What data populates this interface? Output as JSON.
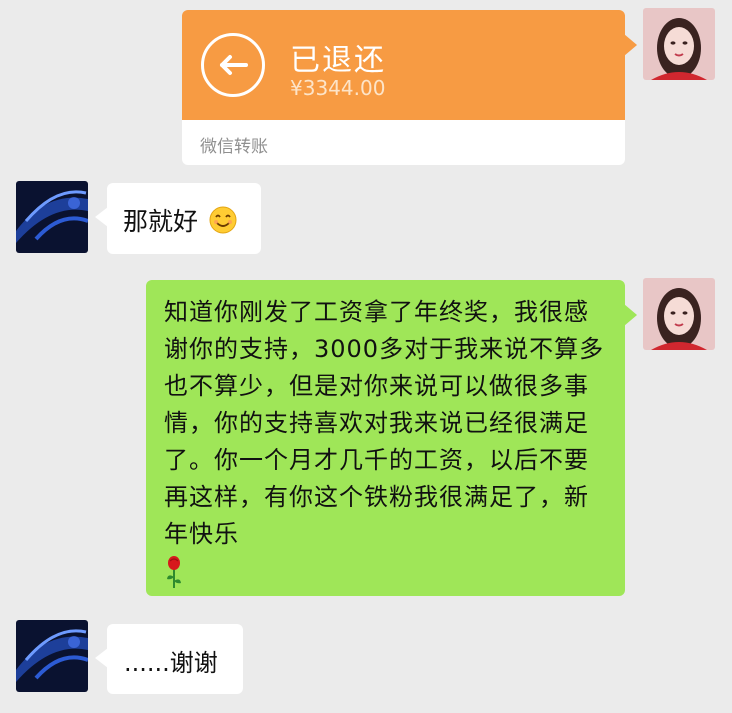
{
  "transfer": {
    "title": "已退还",
    "amount": "¥3344.00",
    "label": "微信转账",
    "icon": "return-arrow-icon",
    "color": "#f79b43"
  },
  "messages": [
    {
      "sender": "other",
      "text": "那就好",
      "emoji": "smile-emoji"
    },
    {
      "sender": "me",
      "text": "知道你刚发了工资拿了年终奖，我很感谢你的支持，3000多对于我来说不算多也不算少，但是对你来说可以做很多事情，你的支持喜欢对我来说已经很满足了。你一个月才几千的工资，以后不要再这样，有你这个铁粉我很满足了，新年快乐",
      "emoji": "rose-emoji"
    },
    {
      "sender": "other",
      "text": "......谢谢"
    }
  ],
  "colors": {
    "background": "#ebebeb",
    "sent_bubble": "#9fe658",
    "received_bubble": "#ffffff"
  }
}
